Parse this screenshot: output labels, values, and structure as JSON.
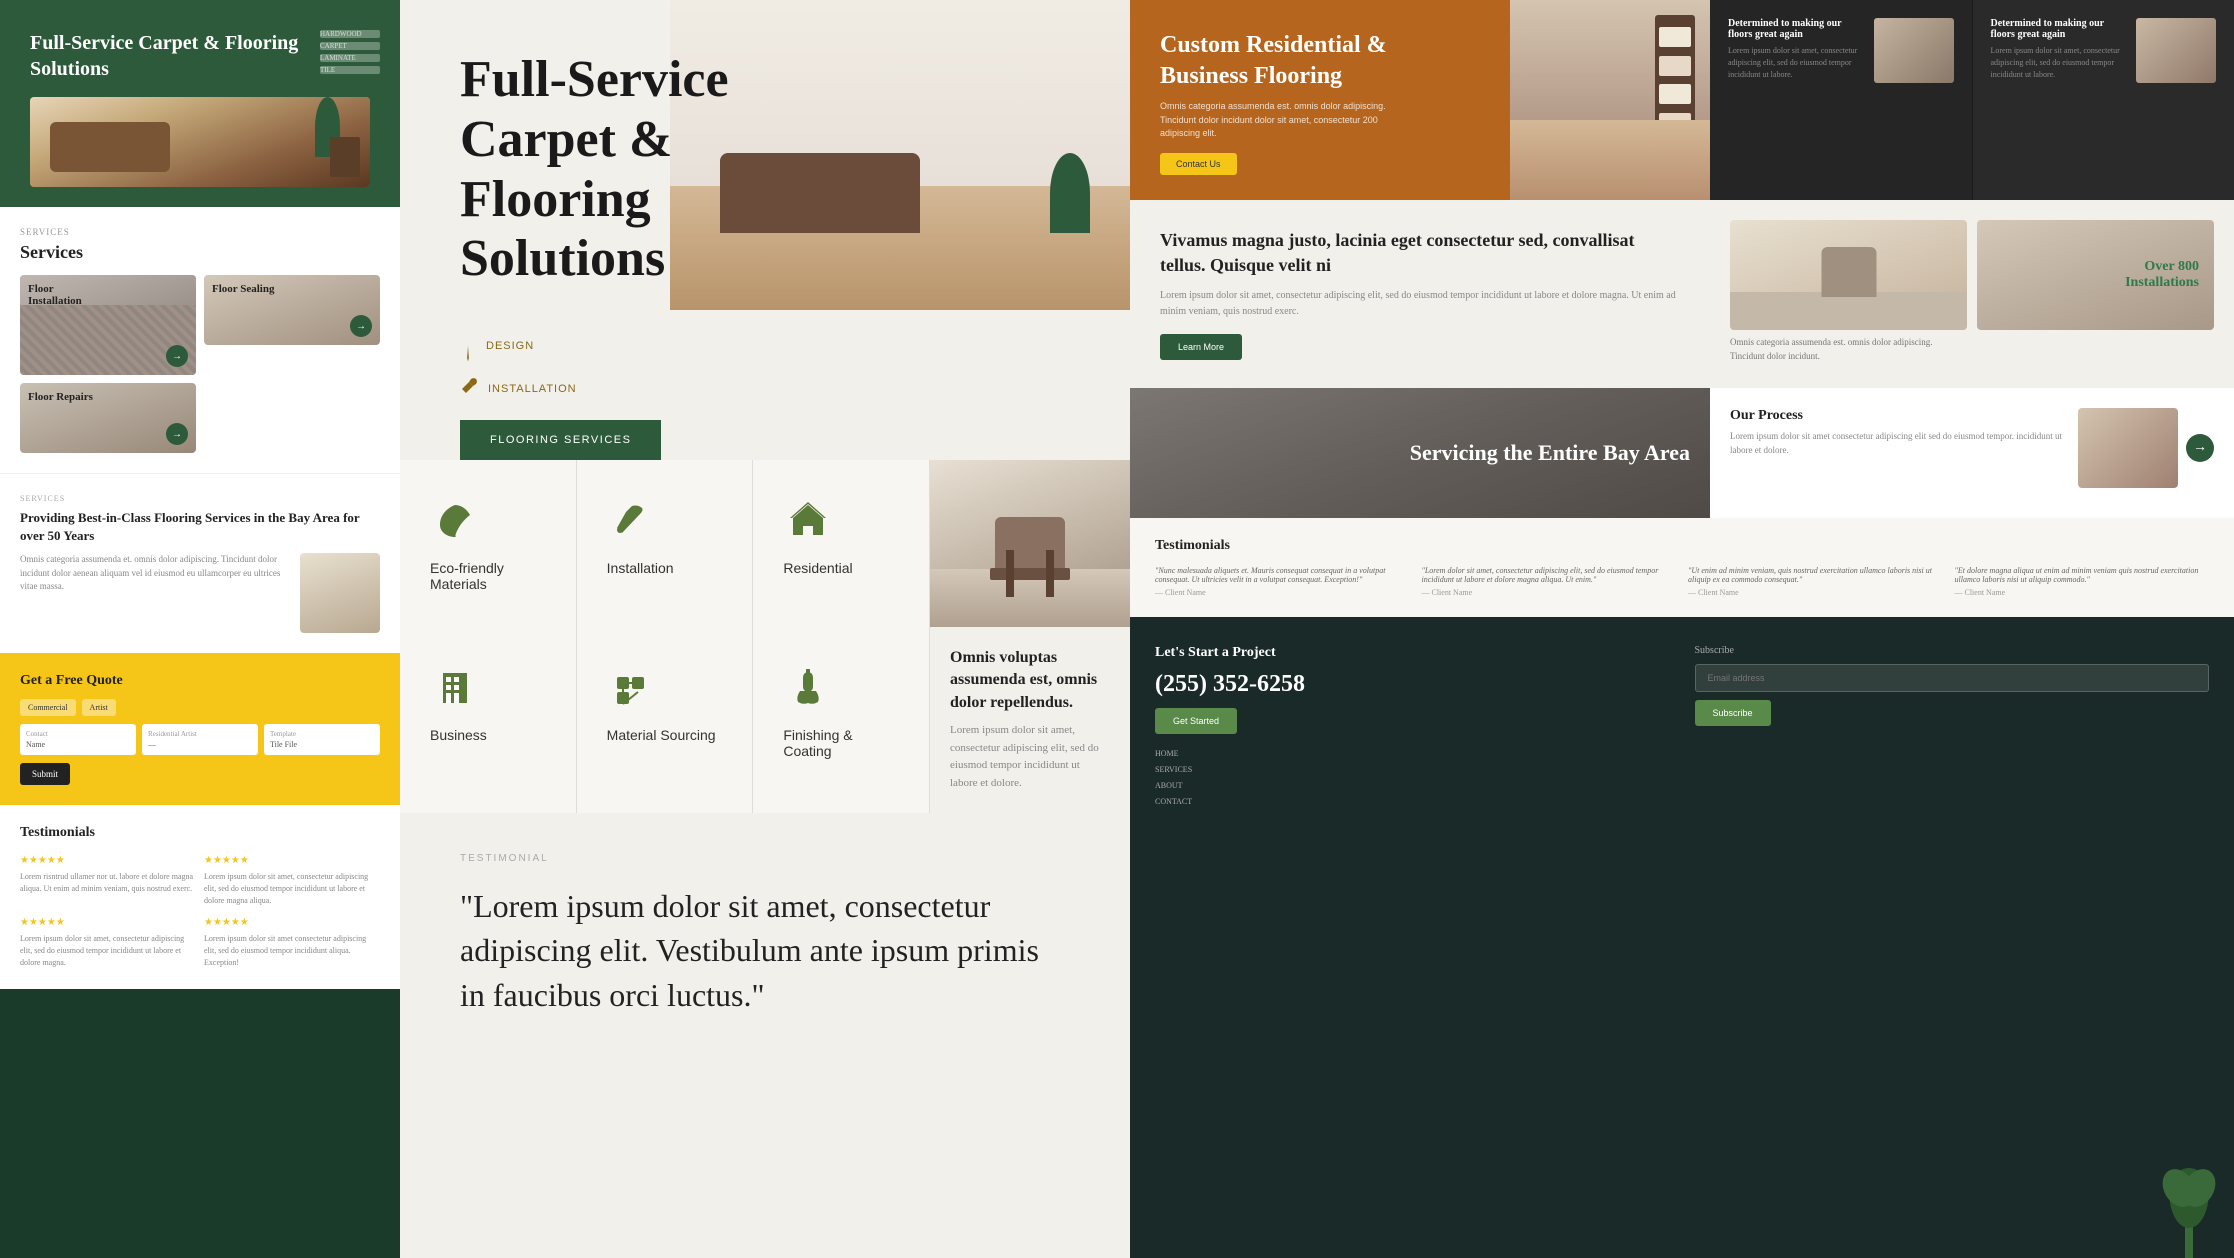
{
  "left": {
    "hero": {
      "title": "Full-Service Carpet & Flooring Solutions",
      "nav_items": [
        "HARDWOOD",
        "CARPET",
        "LAMINATE",
        "TILE"
      ]
    },
    "services": {
      "label": "Services",
      "title": "Services",
      "items": [
        {
          "name": "Floor Installation",
          "size": "large"
        },
        {
          "name": "Floor Sealing",
          "size": "small"
        },
        {
          "name": "Floor Repairs",
          "size": "small"
        }
      ]
    },
    "providing": {
      "label": "Services",
      "title": "Providing Best-in-Class Flooring Services in the Bay Area for over 50 Years",
      "text": "Omnis categoria assumenda et. omnis dolor adipiscing. Tincidunt dolor incidunt dolor aenean aliquam vel id eiusmod eu ullamcorper eu ultrices vitae massa."
    },
    "quote": {
      "title": "Get a Free Quote",
      "btn": "Submit",
      "sub_items": [
        "Commercial",
        "Artist",
        "Residential Artist",
        "Template Tile"
      ],
      "input_label": "Contact"
    },
    "testimonials": {
      "title": "Testimonials",
      "items": [
        {
          "stars": "★★★★★",
          "text": "Lorem risntrud ullamer nor ut. labore et dolore magna aliqua. Ut enim ad minim veniam, quis nostrud exerc."
        },
        {
          "stars": "★★★★★",
          "text": "Lorem ipsum dolor sit amet, consectetur adipiscing elit, sed do eiusmod tempor incididunt ut labore et dolore magna aliqua."
        },
        {
          "stars": "★★★★★",
          "text": "Lorem ipsum dolor sit amet, consectetur adipiscing elit, sed do eiusmod tempor incididunt ut labore et dolore magna."
        },
        {
          "stars": "★★★★★",
          "text": "Lorem ipsum dolor sit amet consectetur adipiscing elit, sed do eiusmod tempor incididunt aliqua. Exception!"
        }
      ]
    }
  },
  "center": {
    "hero": {
      "title": "Full-Service Carpet & Flooring Solutions",
      "design_label": "DESIGN",
      "install_label": "INSTALLATION",
      "services_btn": "FLOORING SERVICES"
    },
    "services": [
      {
        "icon": "🌿",
        "name": "Eco-friendly Materials"
      },
      {
        "icon": "🔧",
        "name": "Installation"
      },
      {
        "icon": "🏠",
        "name": "Residential"
      },
      {
        "icon": "🏢",
        "name": "Business"
      },
      {
        "icon": "⚙️",
        "name": "Material Sourcing"
      },
      {
        "icon": "🔒",
        "name": "Finishing & Coating"
      }
    ],
    "omnis": {
      "title": "Omnis voluptas assumenda est, omnis dolor repellendus.",
      "text": "Lorem ipsum dolor sit amet, consectetur adipiscing elit, sed do eiusmod tempor incididunt ut labore et dolore."
    },
    "testimonial": {
      "label": "TESTIMONIAL",
      "quote": "\"Lorem ipsum dolor sit amet, consectetur adipiscing elit. Vestibulum ante ipsum primis in faucibus orci luctus.\""
    }
  },
  "right": {
    "hero": {
      "title": "Custom Residential & Business Flooring",
      "sub_text": "Omnis categoria assumenda est. omnis dolor adipiscing. Tincidunt dolor incidunt dolor sit amet, consectetur 200 adipiscing elit.",
      "btn": "Contact Us"
    },
    "dark_section": [
      {
        "title": "Determined to making our floors great again",
        "text": "Lorem ipsum dolor sit amet, consectetur adipiscing elit, sed do eiusmod tempor incididunt ut labore."
      },
      {
        "title": "Determined to making our floors great again",
        "text": "Lorem ipsum dolor sit amet, consectetur adipiscing elit, sed do eiusmod tempor incididunt ut labore."
      }
    ],
    "vivamus": {
      "title": "Vivamus magna justo, lacinia eget consectetur sed, convallisat tellus. Quisque velit ni",
      "text": "Lorem ipsum dolor sit amet, consectetur adipiscing elit, sed do eiusmod tempor incididunt ut labore et dolore magna. Ut enim ad minim veniam, quis nostrud exerc.",
      "btn": "Learn More"
    },
    "feature_left": {
      "text": "Omnis categoria assumenda est. omnis dolor adipiscing. Tincidunt dolor incidunt."
    },
    "installations": {
      "count": "Over 800",
      "label": "Installations"
    },
    "bay_area": {
      "title": "Servicing the Entire Bay Area"
    },
    "process": {
      "title": "Our Process",
      "text": "Lorem ipsum dolor sit amet consectetur adipiscing elit sed do eiusmod tempor. incididunt ut labore et dolore."
    },
    "testimonials": {
      "title": "Testimonials",
      "items": [
        {
          "quote": "\"Nunc malesuada aliquets et. Mauris consequat consequat in a volutpat consequat. Ut ultricies velit in a volutpat consequat. Exception!\"",
          "author": "— Client Name"
        },
        {
          "quote": "\"Lorem dolor sit amet, consectetur adipiscing elit, sed do eiusmod tempor incididunt ut labore et dolore magna aliqua. Ut enim.\"",
          "author": "— Client Name"
        },
        {
          "quote": "\"Ut enim ad minim veniam, quis nostrud exercitation ullamco laboris nisi ut aliquip ex ea commodo consequat.\"",
          "author": "— Client Name"
        },
        {
          "quote": "\"Et dolore magna aliqua ut enim ad minim veniam quis nostrud exercitation ullamco laboris nisi ut aliquip commodo.\"",
          "author": "— Client Name"
        }
      ]
    },
    "cta": {
      "title": "Let's Start a Project",
      "phone": "(255) 352-6258",
      "btn": "Get Started",
      "subscribe_label": "Subscribe",
      "sub_btn": "Subscribe",
      "nav_items": [
        "HOME",
        "SERVICES",
        "ABOUT",
        "CONTACT"
      ]
    }
  }
}
